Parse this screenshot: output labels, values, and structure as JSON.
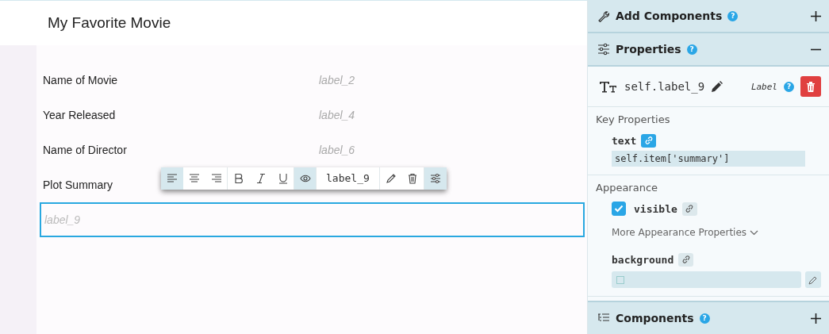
{
  "page": {
    "title": "My Favorite Movie"
  },
  "form_rows": [
    {
      "label": "Name of Movie",
      "value": "label_2"
    },
    {
      "label": "Year Released",
      "value": "label_4"
    },
    {
      "label": "Name of Director",
      "value": "label_6"
    },
    {
      "label": "Plot Summary"
    }
  ],
  "selected_component": {
    "text": "label_9"
  },
  "toolbar": [
    {
      "kind": "align-left",
      "selected": true
    },
    {
      "kind": "align-center",
      "selected": false
    },
    {
      "kind": "align-right",
      "selected": false
    },
    {
      "kind": "bold",
      "selected": false
    },
    {
      "kind": "italic",
      "selected": false
    },
    {
      "kind": "underline",
      "selected": false
    },
    {
      "kind": "eye",
      "selected": true
    },
    {
      "kind": "name",
      "text": "label_9"
    },
    {
      "kind": "edit",
      "selected": false
    },
    {
      "kind": "delete",
      "selected": false
    },
    {
      "kind": "sliders",
      "selected": true
    }
  ],
  "panel": {
    "help": "?",
    "add_components": {
      "title": "Add Components",
      "expanded": false
    },
    "properties": {
      "title": "Properties",
      "expanded": true,
      "component": {
        "name": "self.label_9",
        "type": "Label"
      },
      "key_properties": {
        "heading": "Key Properties",
        "property": "text",
        "binding": "self.item['summary']"
      },
      "appearance": {
        "heading": "Appearance",
        "visible": {
          "label": "visible",
          "checked": true
        },
        "more": "More Appearance Properties",
        "background": {
          "label": "background"
        }
      }
    },
    "components": {
      "title": "Components",
      "expanded": false
    }
  }
}
